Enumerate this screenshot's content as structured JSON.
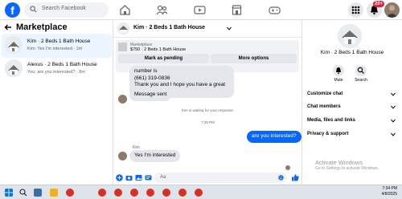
{
  "top": {
    "search_placeholder": "Search Facebook",
    "notification_badge": "20+",
    "brand_color": "#0866ff"
  },
  "sidebar": {
    "title": "Marketplace",
    "conversations": [
      {
        "name": "Kim · 2 Beds 1 Bath House",
        "preview": "Kim: Yes I'm interested · 1m",
        "active": true
      },
      {
        "name": "Alexus · 2 Beds 1 Bath House",
        "preview": "You: are you interested? · 8m",
        "active": false
      }
    ]
  },
  "chat": {
    "title": "Kim · 2 Beds 1 Bath House",
    "listing_label": "Marketplace",
    "listing_price": "$750 · 2 Beds 1 Bath House",
    "mark_pending": "Mark as pending",
    "more_options": "More options",
    "msg1_lines": [
      "number is",
      "(661) 319-0836",
      "Thank you and I hope you have a great day!"
    ],
    "msg2": "Message sent",
    "waiting": "Kim is waiting for your response.",
    "time": "7:25 PM",
    "outgoing": "are you interested?",
    "sender_name": "Kim",
    "incoming": "Yes I'm interested",
    "composer_placeholder": "Aa"
  },
  "details": {
    "name": "Kim · 2 Beds 1 Bath House",
    "mute_label": "Mute",
    "search_label": "Search",
    "menu": [
      "Customize chat",
      "Chat members",
      "Media, files and links",
      "Privacy & support"
    ]
  },
  "watermark": {
    "line1": "Activate Windows",
    "line2": "Go to Settings to activate Windows."
  },
  "taskbar": {
    "time": "7:34 PM",
    "date": "4/8/2025"
  }
}
